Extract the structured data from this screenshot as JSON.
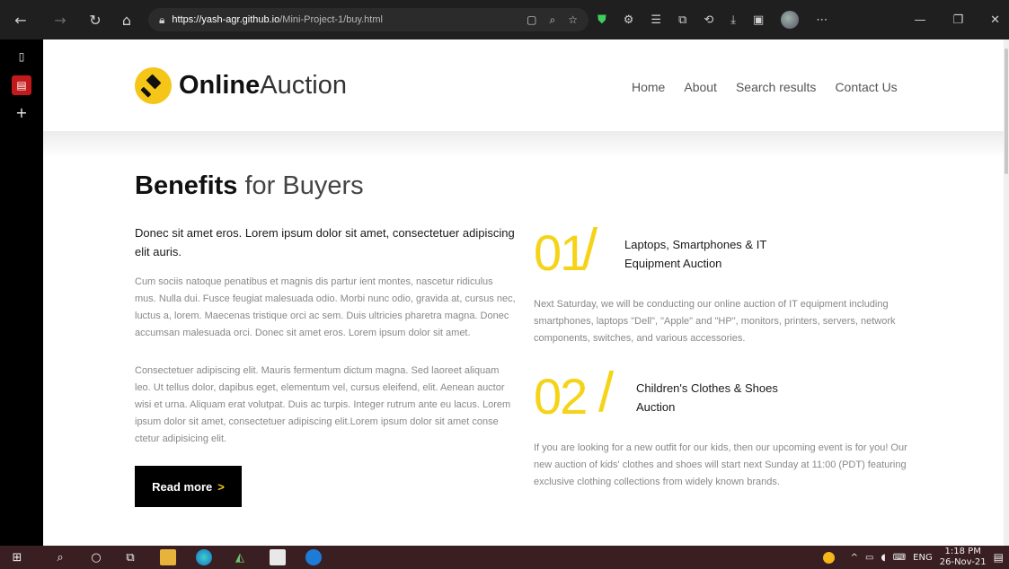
{
  "browser": {
    "url_host": "https://yash-agr.github.io",
    "url_path": "/Mini-Project-1/buy.html"
  },
  "site": {
    "logo_bold": "Online",
    "logo_light": "Auction",
    "menu": [
      "Home",
      "About",
      "Search results",
      "Contact Us"
    ]
  },
  "content": {
    "title_bold": "Benefits",
    "title_light": " for Buyers",
    "lead": "Donec sit amet eros. Lorem ipsum dolor sit amet, consectetuer adipiscing elit auris.",
    "para1": "Cum sociis natoque penatibus et magnis dis partur ient montes, nascetur ridiculus mus. Nulla dui. Fusce feugiat malesuada odio. Morbi nunc odio, gravida at, cursus nec, luctus a, lorem. Maecenas tristique orci ac sem. Duis ultricies pharetra magna. Donec accumsan malesuada orci. Donec sit amet eros. Lorem ipsum dolor sit amet.",
    "para2": "Consectetuer adipiscing elit. Mauris fermentum dictum magna. Sed laoreet aliquam leo. Ut tellus dolor, dapibus eget, elementum vel, cursus eleifend, elit. Aenean auctor wisi et urna. Aliquam erat volutpat. Duis ac turpis. Integer rutrum ante eu lacus. Lorem ipsum dolor sit amet, consectetuer adipiscing elit.Lorem ipsum dolor sit amet conse ctetur adipisicing elit.",
    "button_label": "Read more",
    "button_arrow": ">",
    "items": [
      {
        "number": "01",
        "slash": "/",
        "title": "Laptops, Smartphones & IT Equipment Auction",
        "desc": "Next Saturday, we will be conducting our online auction of IT equipment including smartphones, laptops \"Dell\", \"Apple\" and \"HP\", monitors, printers, servers, network components, switches, and various accessories."
      },
      {
        "number": "02",
        "slash": "/",
        "title": "Children's Clothes & Shoes Auction",
        "desc": "If you are looking for a new outfit for our kids, then our upcoming event is for you! Our new auction of kids' clothes and shoes will start next Sunday at 11:00 (PDT) featuring exclusive clothing collections from widely known brands."
      }
    ]
  },
  "taskbar": {
    "lang": "ENG",
    "time": "1:18 PM",
    "date": "26-Nov-21"
  },
  "colors": {
    "accent": "#f5d318",
    "button_bg": "#000000"
  }
}
